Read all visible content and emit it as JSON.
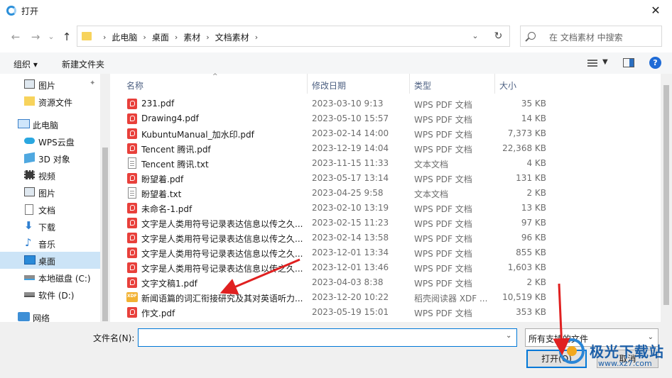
{
  "window": {
    "title": "打开",
    "close_glyph": "✕"
  },
  "nav": {
    "back_glyph": "←",
    "forward_glyph": "→",
    "recent_glyph": "⌄",
    "up_glyph": "↑",
    "breadcrumbs": [
      "此电脑",
      "桌面",
      "素材",
      "文档素材"
    ],
    "separator": "›",
    "dropdown_glyph": "⌄",
    "refresh_glyph": "↻"
  },
  "search": {
    "placeholder": "在 文档素材 中搜索"
  },
  "toolbar": {
    "organize_label": "组织 ▾",
    "new_folder_label": "新建文件夹",
    "view_dropdown_glyph": "▼",
    "help_glyph": "?"
  },
  "sidebar": {
    "items": [
      {
        "label": "图片",
        "icon": "pictures-icon",
        "pinned": true
      },
      {
        "label": "资源文件",
        "icon": "folder-icon"
      },
      {
        "label": "此电脑",
        "icon": "computer-icon"
      },
      {
        "label": "WPS云盘",
        "icon": "cloud-icon"
      },
      {
        "label": "3D 对象",
        "icon": "cube-icon"
      },
      {
        "label": "视频",
        "icon": "video-icon"
      },
      {
        "label": "图片",
        "icon": "pictures-icon"
      },
      {
        "label": "文档",
        "icon": "document-icon"
      },
      {
        "label": "下载",
        "icon": "download-icon"
      },
      {
        "label": "音乐",
        "icon": "music-icon"
      },
      {
        "label": "桌面",
        "icon": "desktop-icon",
        "selected": true
      },
      {
        "label": "本地磁盘 (C:)",
        "icon": "drive-icon"
      },
      {
        "label": "软件 (D:)",
        "icon": "drive-icon"
      },
      {
        "label": "网络",
        "icon": "network-icon"
      }
    ],
    "pin_glyph": "📌"
  },
  "columns": {
    "name": "名称",
    "date": "修改日期",
    "type": "类型",
    "size": "大小",
    "sort_glyph": "^"
  },
  "files": [
    {
      "name": "231.pdf",
      "date": "2023-03-10 9:13",
      "type": "WPS PDF 文档",
      "size": "35 KB",
      "kind": "pdf"
    },
    {
      "name": "Drawing4.pdf",
      "date": "2023-05-10 15:57",
      "type": "WPS PDF 文档",
      "size": "14 KB",
      "kind": "pdf"
    },
    {
      "name": "KubuntuManual_加水印.pdf",
      "date": "2023-02-14 14:00",
      "type": "WPS PDF 文档",
      "size": "7,373 KB",
      "kind": "pdf"
    },
    {
      "name": "Tencent 腾讯.pdf",
      "date": "2023-12-19 14:04",
      "type": "WPS PDF 文档",
      "size": "22,368 KB",
      "kind": "pdf"
    },
    {
      "name": "Tencent 腾讯.txt",
      "date": "2023-11-15 11:33",
      "type": "文本文档",
      "size": "4 KB",
      "kind": "txt"
    },
    {
      "name": "盼望着.pdf",
      "date": "2023-05-17 13:14",
      "type": "WPS PDF 文档",
      "size": "131 KB",
      "kind": "pdf"
    },
    {
      "name": "盼望着.txt",
      "date": "2023-04-25 9:58",
      "type": "文本文档",
      "size": "2 KB",
      "kind": "txt"
    },
    {
      "name": "未命名-1.pdf",
      "date": "2023-02-10 13:19",
      "type": "WPS PDF 文档",
      "size": "13 KB",
      "kind": "pdf"
    },
    {
      "name": "文字是人类用符号记录表达信息以传之久...",
      "date": "2023-02-15 11:23",
      "type": "WPS PDF 文档",
      "size": "97 KB",
      "kind": "pdf"
    },
    {
      "name": "文字是人类用符号记录表达信息以传之久...",
      "date": "2023-02-14 13:58",
      "type": "WPS PDF 文档",
      "size": "96 KB",
      "kind": "pdf"
    },
    {
      "name": "文字是人类用符号记录表达信息以传之久...",
      "date": "2023-12-01 13:34",
      "type": "WPS PDF 文档",
      "size": "855 KB",
      "kind": "pdf"
    },
    {
      "name": "文字是人类用符号记录表达信息以传之久...",
      "date": "2023-12-01 13:46",
      "type": "WPS PDF 文档",
      "size": "1,603 KB",
      "kind": "pdf"
    },
    {
      "name": "文字文稿1.pdf",
      "date": "2023-04-03 8:38",
      "type": "WPS PDF 文档",
      "size": "2 KB",
      "kind": "pdf"
    },
    {
      "name": "新闻语篇的词汇衔接研究及其对英语听力...",
      "date": "2023-12-20 10:22",
      "type": "稻壳阅读器 XDF ...",
      "size": "10,519 KB",
      "kind": "xdf"
    },
    {
      "name": "作文.pdf",
      "date": "2023-05-19 15:01",
      "type": "WPS PDF 文档",
      "size": "353 KB",
      "kind": "pdf"
    }
  ],
  "footer": {
    "filename_label": "文件名(N):",
    "filename_value": "",
    "filename_dropdown_glyph": "⌄",
    "filetype_value": "所有支持的文件",
    "filetype_dropdown_glyph": "⌄",
    "open_label": "打开(O)",
    "cancel_label": "取消"
  },
  "watermark": {
    "text": "极光下载站",
    "url": "www.xz7.com"
  },
  "colors": {
    "accent": "#0078d7",
    "selected": "#cce4f7",
    "pdf_icon": "#e8403b",
    "annotation_arrow": "#e02020"
  }
}
